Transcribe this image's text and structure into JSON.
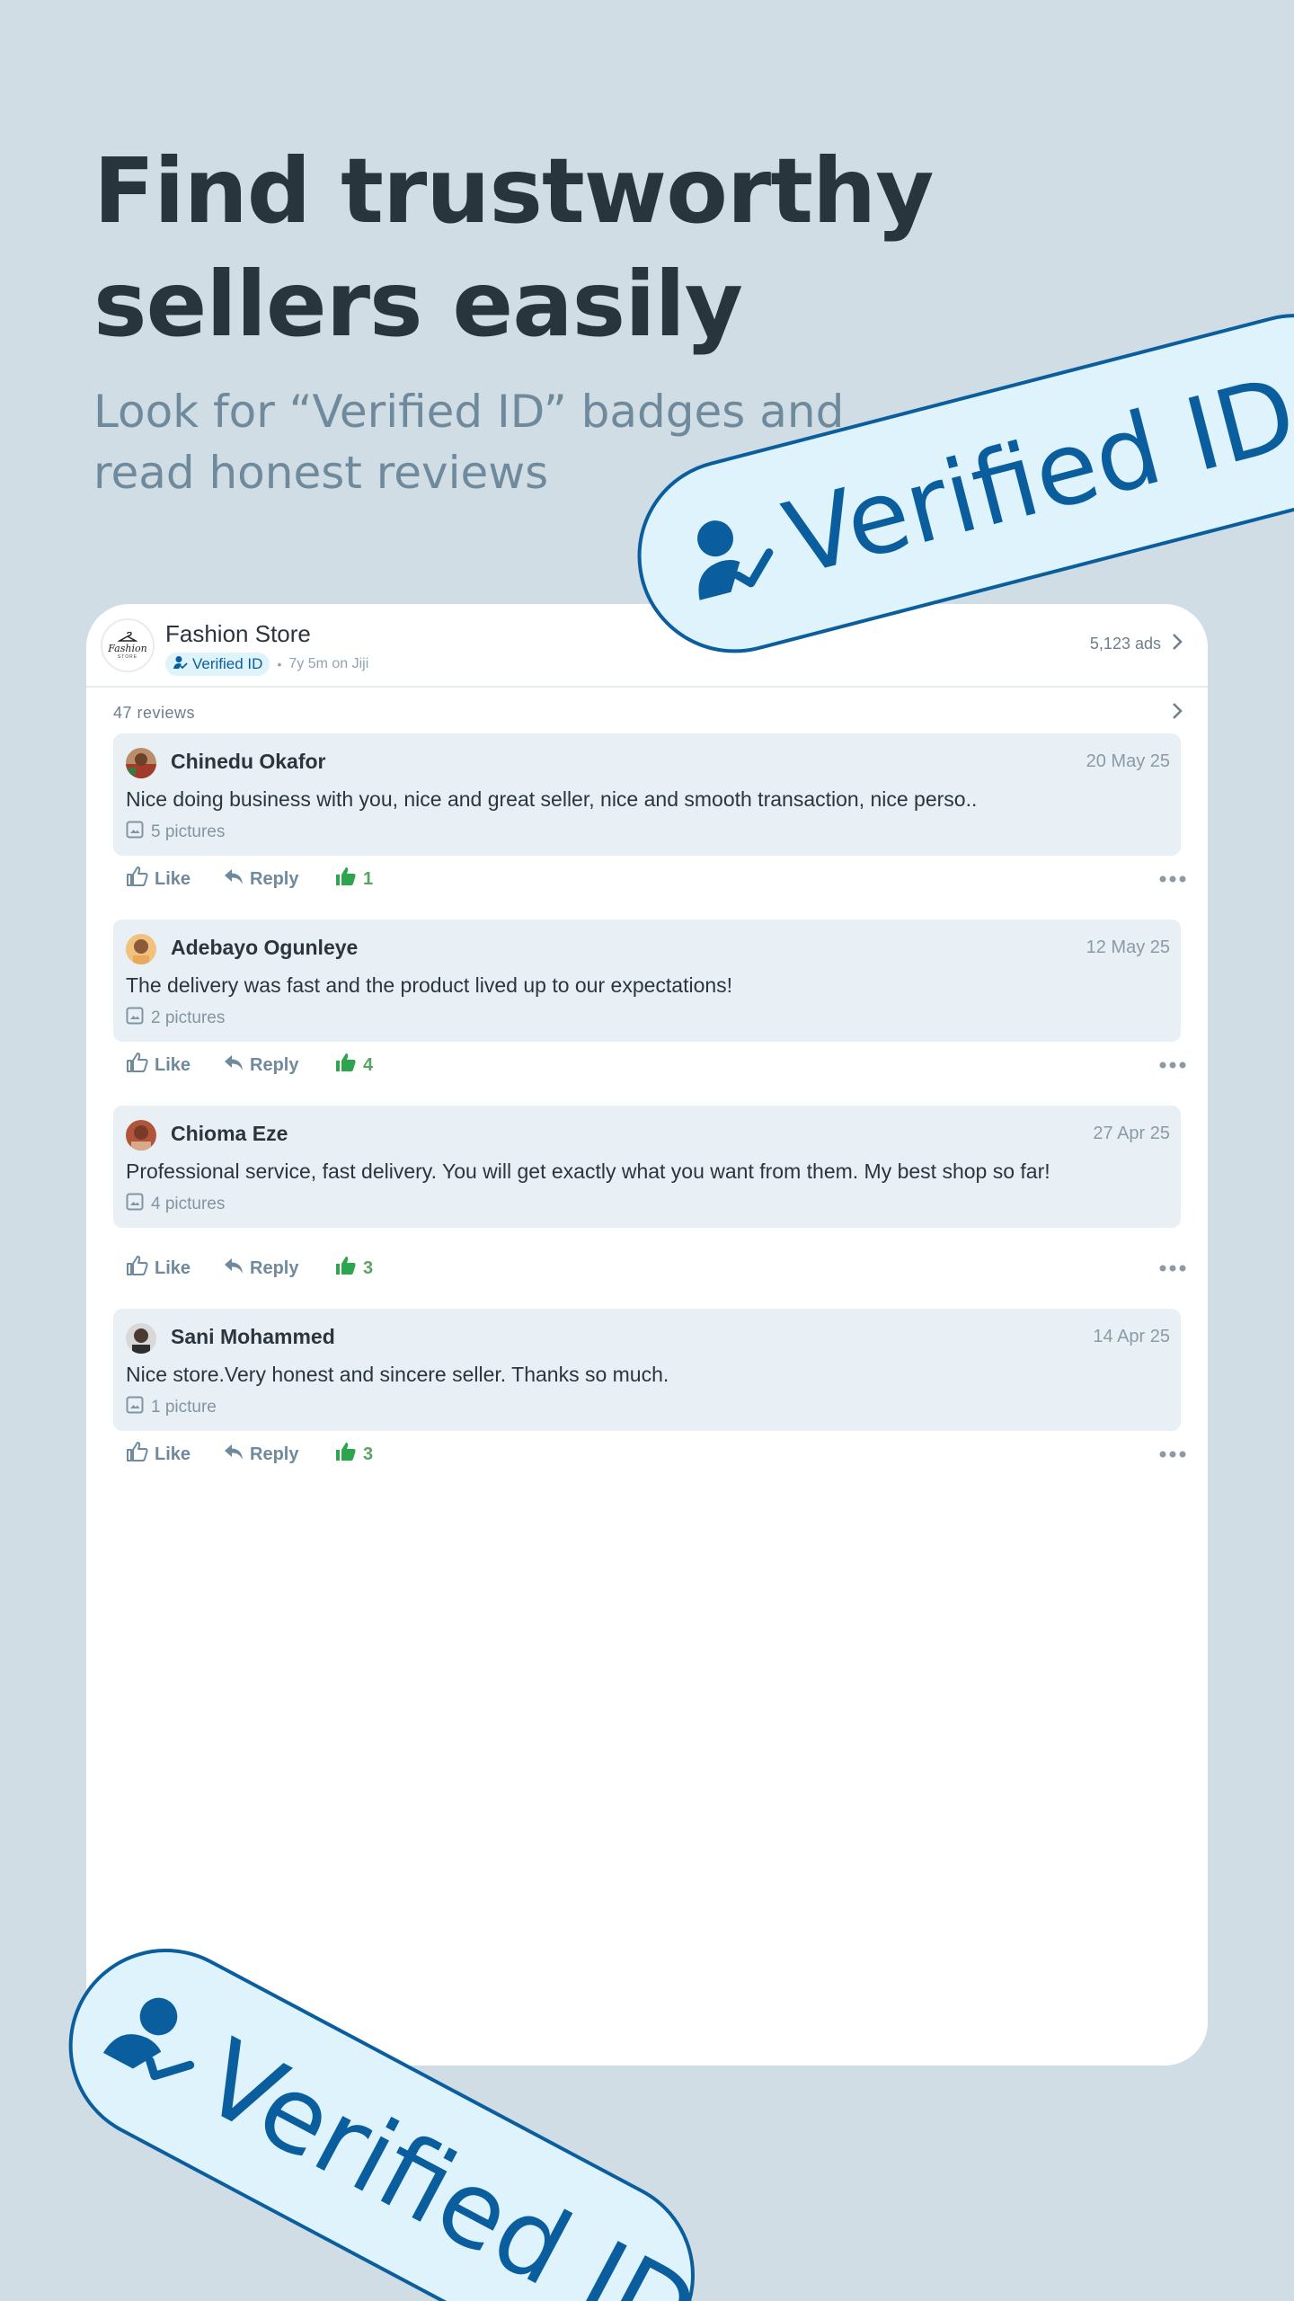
{
  "hero": {
    "title": "Find trustworthy sellers easily",
    "subtitle": "Look for “Verified ID” badges and read honest reviews"
  },
  "store": {
    "name": "Fashion Store",
    "logo_text": "Fashion",
    "logo_subtext": "STORE",
    "verified_label": "Verified ID",
    "separator": "•",
    "member_since": "7y 5m on Jiji",
    "ads_count": "5,123 ads"
  },
  "reviews_header": {
    "count_label": "47 reviews"
  },
  "reviews": [
    {
      "author": "Chinedu Okafor",
      "date": "20 May 25",
      "text": "Nice doing business with you, nice and great seller, nice and smooth transaction, nice perso..",
      "pictures": "5 pictures",
      "like_label": "Like",
      "reply_label": "Reply",
      "likes": "1"
    },
    {
      "author": "Adebayo Ogunleye",
      "date": "12 May 25",
      "text": "The delivery was fast and the product lived up to our expectations!",
      "pictures": "2 pictures",
      "like_label": "Like",
      "reply_label": "Reply",
      "likes": "4"
    },
    {
      "author": "Chioma Eze",
      "date": "27 Apr 25",
      "text": "Professional service, fast delivery. You will get exactly what you want from them. My best shop so far!",
      "pictures": "4 pictures",
      "like_label": "Like",
      "reply_label": "Reply",
      "likes": "3"
    },
    {
      "author": "Sani Mohammed",
      "date": "14 Apr 25",
      "text": "Nice store.Very honest and sincere seller. Thanks so much.",
      "pictures": "1 picture",
      "like_label": "Like",
      "reply_label": "Reply",
      "likes": "3"
    }
  ],
  "stamps": {
    "label": "Verified ID"
  },
  "colors": {
    "background": "#d0dde4",
    "brand_blue": "#0b5e9e",
    "stamp_fill": "#def3fb",
    "like_green": "#2ea44f",
    "review_bg": "#e8f0f6"
  },
  "icons": [
    "verified-user-icon",
    "chevron-right-icon",
    "image-icon",
    "thumb-up-outline-icon",
    "reply-icon",
    "thumb-up-filled-icon",
    "more-horizontal-icon",
    "hanger-icon"
  ]
}
